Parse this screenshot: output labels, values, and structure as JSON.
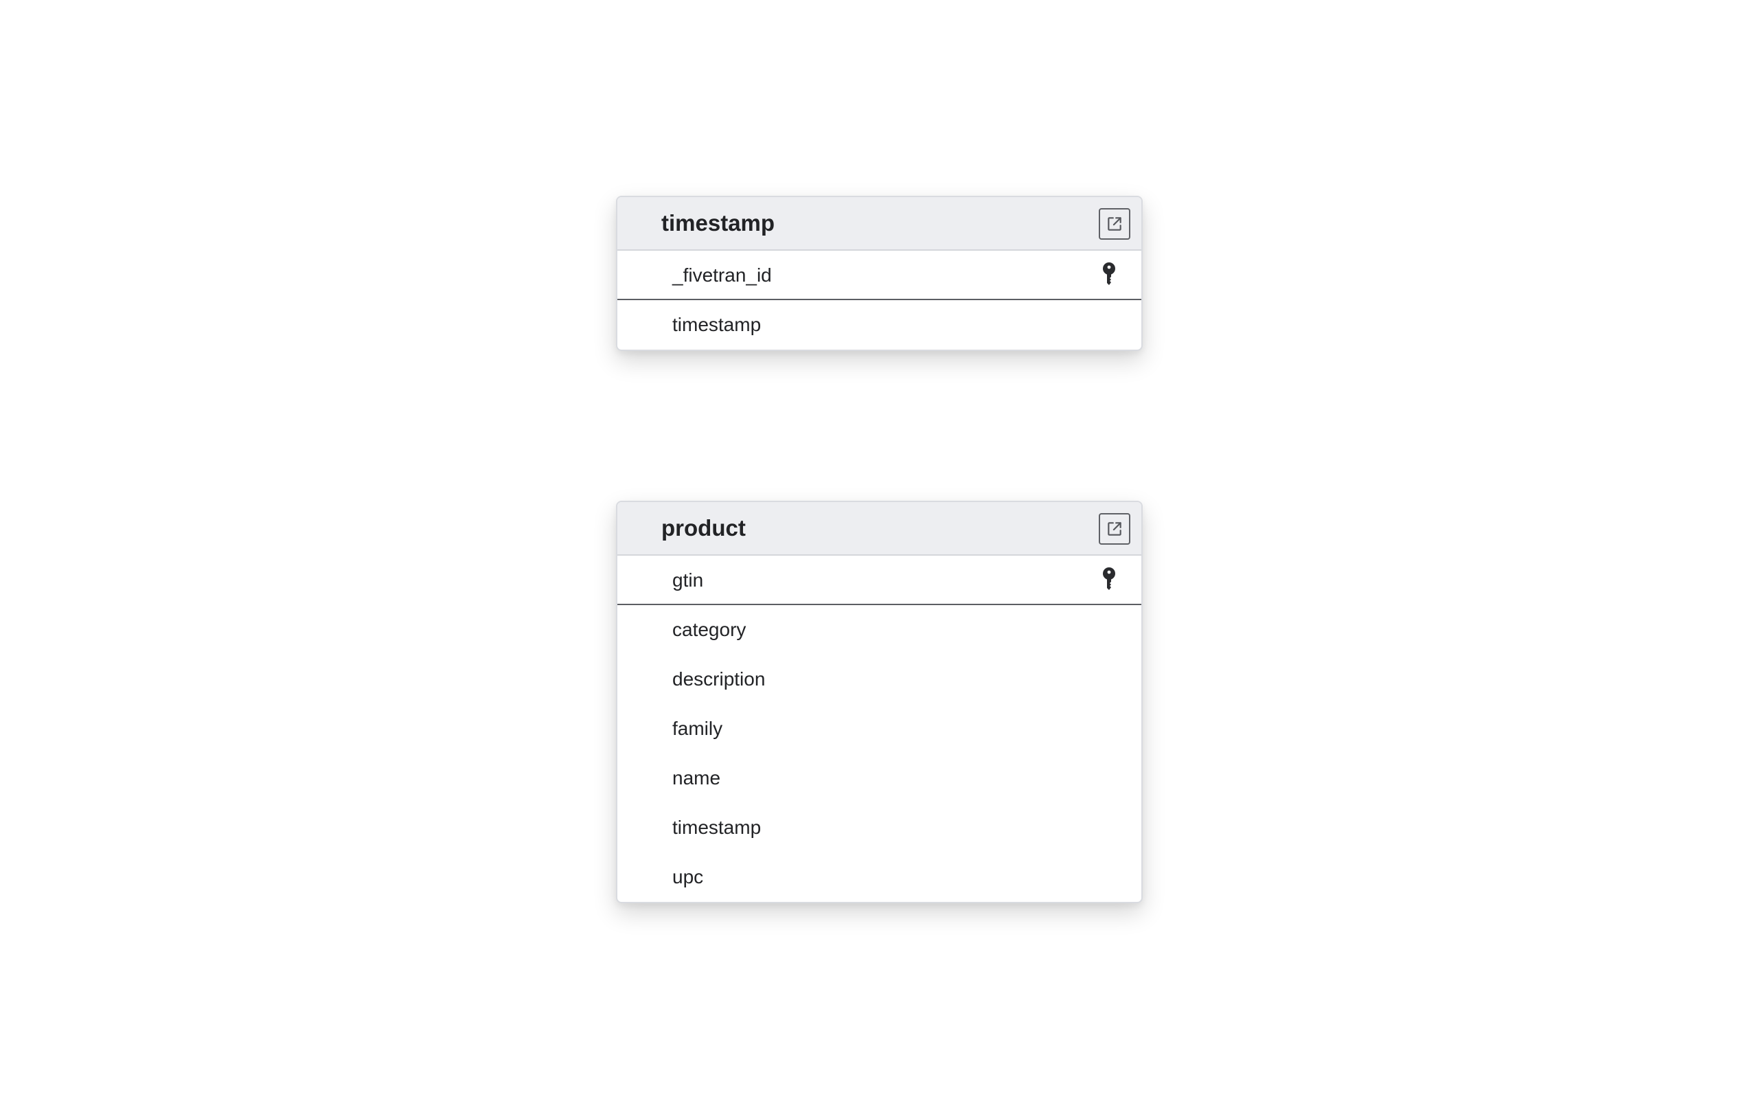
{
  "tables": [
    {
      "name": "timestamp",
      "open_icon": "external-link-icon",
      "primary_key": {
        "label": "_fivetran_id",
        "icon": "key-icon"
      },
      "columns": [
        "timestamp"
      ]
    },
    {
      "name": "product",
      "open_icon": "external-link-icon",
      "primary_key": {
        "label": "gtin",
        "icon": "key-icon"
      },
      "columns": [
        "category",
        "description",
        "family",
        "name",
        "timestamp",
        "upc"
      ]
    }
  ],
  "colors": {
    "header_bg": "#edeef1",
    "border": "#d9dbe0",
    "pk_divider": "#5c5e63",
    "text": "#222326"
  }
}
